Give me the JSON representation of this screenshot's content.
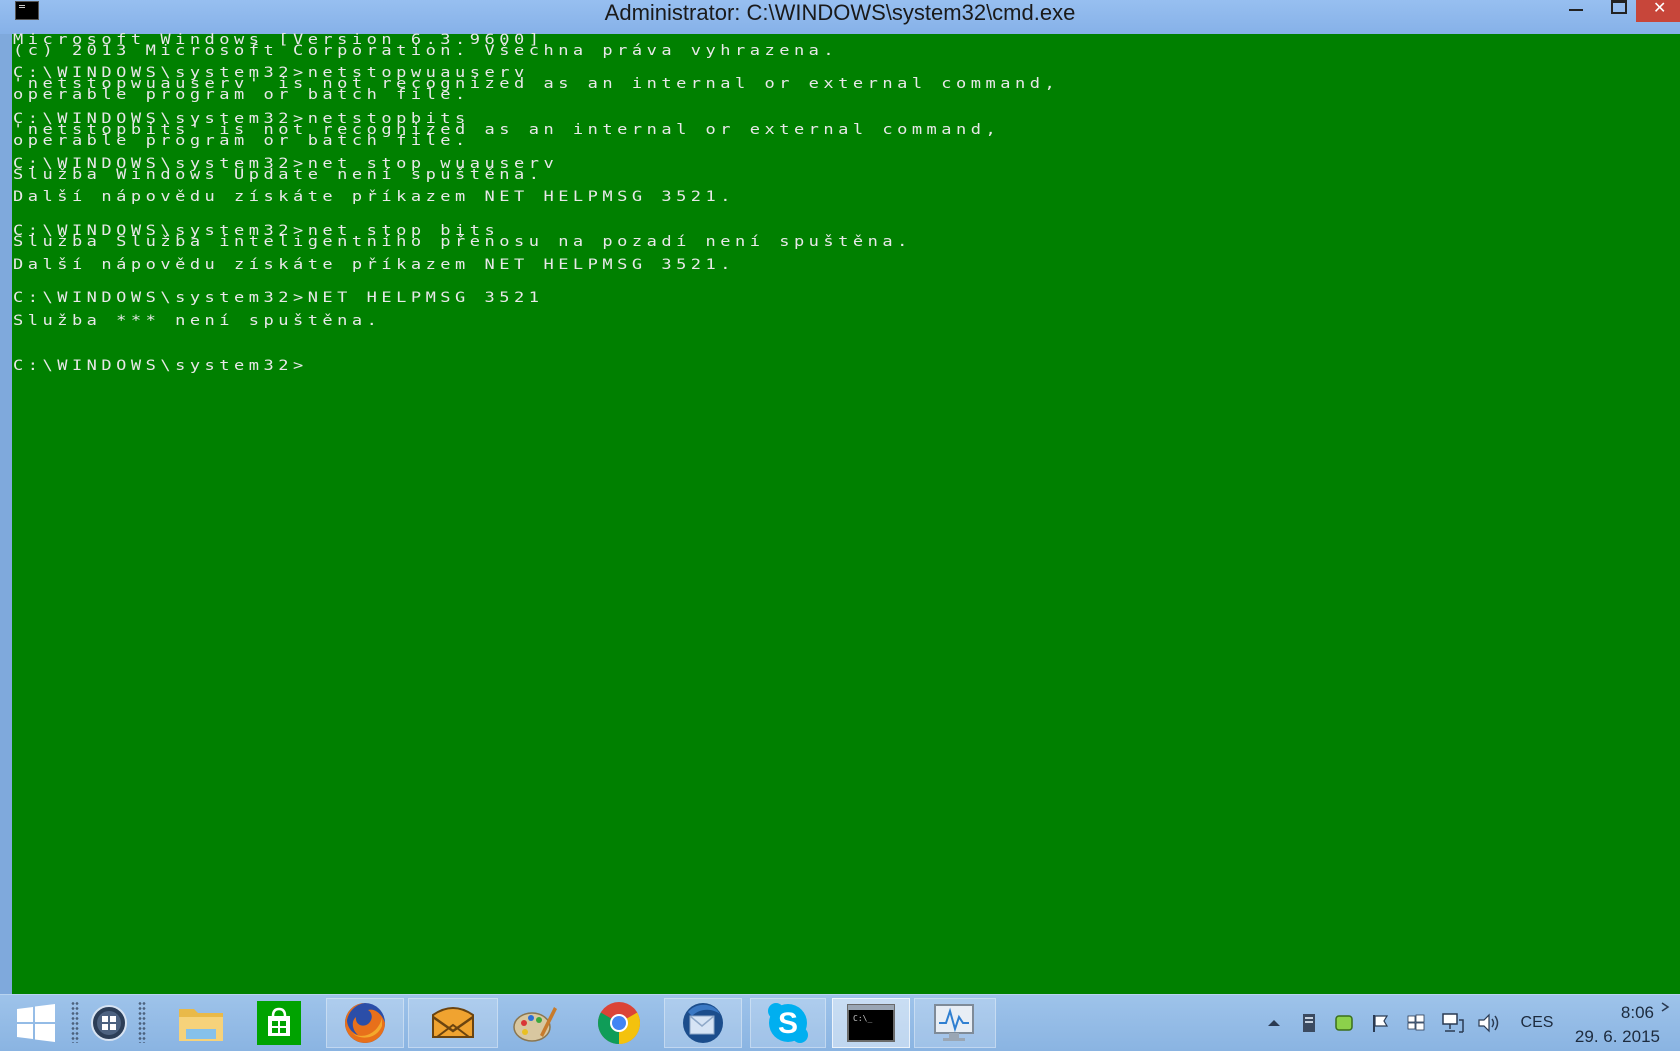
{
  "window": {
    "title": "Administrator: C:\\WINDOWS\\system32\\cmd.exe"
  },
  "console": {
    "lines": [
      "Microsoft Windows [Version 6.3.9600]",
      "(c) 2013 Microsoft Corporation. Všechna práva vyhrazena.",
      "",
      "C:\\WINDOWS\\system32>netstopwuauserv",
      "'netstopwuauserv' is not recognized as an internal or external command,",
      "operable program or batch file.",
      "",
      "C:\\WINDOWS\\system32>netstopbits",
      "'netstopbits' is not recognized as an internal or external command,",
      "operable program or batch file.",
      "",
      "C:\\WINDOWS\\system32>net stop wuauserv",
      "Služba Windows Update není spuštěna.",
      "",
      "Další nápovědu získáte příkazem NET HELPMSG 3521.",
      "",
      "",
      "C:\\WINDOWS\\system32>net stop bits",
      "Služba Služba inteligentního přenosu na pozadí není spuštěna.",
      "",
      "Další nápovědu získáte příkazem NET HELPMSG 3521.",
      "",
      "",
      "C:\\WINDOWS\\system32>NET HELPMSG 3521",
      "",
      "Služba *** není spuštěna.",
      "",
      "",
      "",
      "C:\\WINDOWS\\system32>"
    ],
    "background": "#008000",
    "foreground": "#e8e8e8"
  },
  "taskbar": {
    "items": [
      {
        "name": "start-button",
        "icon": "windows-logo-icon"
      },
      {
        "name": "taskbar-app-system-menu",
        "icon": "system-menu-icon"
      },
      {
        "name": "taskbar-app-file-explorer",
        "icon": "folder-icon"
      },
      {
        "name": "taskbar-app-store",
        "icon": "store-icon"
      },
      {
        "name": "taskbar-app-firefox",
        "icon": "firefox-icon"
      },
      {
        "name": "taskbar-app-mail",
        "icon": "mail-icon"
      },
      {
        "name": "taskbar-app-paint",
        "icon": "paint-palette-icon"
      },
      {
        "name": "taskbar-app-chrome",
        "icon": "chrome-icon"
      },
      {
        "name": "taskbar-app-thunderbird",
        "icon": "thunderbird-icon"
      },
      {
        "name": "taskbar-app-skype",
        "icon": "skype-icon"
      },
      {
        "name": "taskbar-app-cmd",
        "icon": "command-prompt-icon"
      },
      {
        "name": "taskbar-app-resource-monitor",
        "icon": "resource-monitor-icon"
      }
    ],
    "tray": {
      "language": "CES",
      "time": "8:06",
      "date": "29. 6. 2015"
    }
  }
}
